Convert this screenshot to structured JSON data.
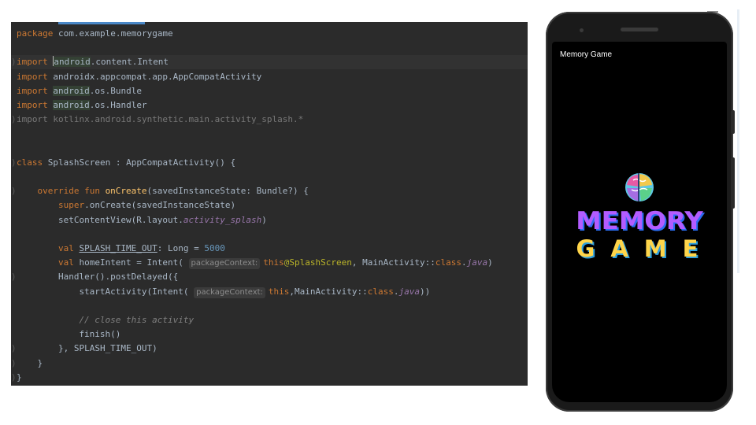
{
  "editor": {
    "lines": [
      {
        "row": 0,
        "indent": 0,
        "gutter": "",
        "segs": [
          [
            "package ",
            "kw"
          ],
          [
            "com.example.memorygame",
            ""
          ]
        ]
      },
      {
        "row": 2,
        "indent": 0,
        "gutter": ")",
        "caret": true,
        "segs": [
          [
            "import ",
            "kw"
          ],
          [
            "|",
            "cursor"
          ],
          [
            "android",
            "hl"
          ],
          [
            ".content.Intent",
            ""
          ]
        ]
      },
      {
        "row": 3,
        "indent": 0,
        "gutter": "",
        "segs": [
          [
            "import ",
            "kw"
          ],
          [
            "androidx.appcompat.app.AppCompatActivity",
            ""
          ]
        ]
      },
      {
        "row": 4,
        "indent": 0,
        "gutter": "",
        "segs": [
          [
            "import ",
            "kw"
          ],
          [
            "android",
            "hl"
          ],
          [
            ".os.Bundle",
            ""
          ]
        ]
      },
      {
        "row": 5,
        "indent": 0,
        "gutter": "",
        "segs": [
          [
            "import ",
            "kw"
          ],
          [
            "android",
            "hl"
          ],
          [
            ".os.Handler",
            ""
          ]
        ]
      },
      {
        "row": 6,
        "indent": 0,
        "gutter": ")",
        "segs": [
          [
            "import kotlinx.android.synthetic.main.activity_splash.*",
            "dim"
          ]
        ]
      },
      {
        "row": 9,
        "indent": 0,
        "gutter": ")",
        "segs": [
          [
            "class ",
            "kw"
          ],
          [
            "SplashScreen : AppCompatActivity() {",
            ""
          ]
        ]
      },
      {
        "row": 11,
        "indent": 4,
        "gutter": ")",
        "segs": [
          [
            "override fun ",
            "kw"
          ],
          [
            "onCreate",
            "fn"
          ],
          [
            "(savedInstanceState: Bundle?) {",
            ""
          ]
        ]
      },
      {
        "row": 12,
        "indent": 8,
        "gutter": "",
        "segs": [
          [
            "super",
            "kw"
          ],
          [
            ".onCreate(savedInstanceState)",
            ""
          ]
        ]
      },
      {
        "row": 13,
        "indent": 8,
        "gutter": "",
        "segs": [
          [
            "setContentView(R.layout.",
            ""
          ],
          [
            "activity_splash",
            "ital"
          ],
          [
            ")",
            ""
          ]
        ]
      },
      {
        "row": 15,
        "indent": 8,
        "gutter": "",
        "segs": [
          [
            "val ",
            "kw"
          ],
          [
            "SPLASH_TIME_OUT",
            "ul"
          ],
          [
            ": Long = ",
            ""
          ],
          [
            "5000",
            "num"
          ]
        ]
      },
      {
        "row": 16,
        "indent": 8,
        "gutter": "",
        "segs": [
          [
            "val ",
            "kw"
          ],
          [
            "homeIntent = Intent( ",
            ""
          ],
          [
            "packageContext:",
            "hint"
          ],
          [
            "this",
            "kw"
          ],
          [
            "@SplashScreen",
            "at"
          ],
          [
            ", MainActivity::",
            ""
          ],
          [
            "class",
            "kw"
          ],
          [
            ".",
            ""
          ],
          [
            "java",
            "ital"
          ],
          [
            ")",
            ""
          ]
        ]
      },
      {
        "row": 17,
        "indent": 8,
        "gutter": ")",
        "segs": [
          [
            "Handler().postDelayed({",
            ""
          ]
        ]
      },
      {
        "row": 18,
        "indent": 12,
        "gutter": "",
        "segs": [
          [
            "startActivity(Intent( ",
            ""
          ],
          [
            "packageContext:",
            "hint"
          ],
          [
            "this",
            "kw"
          ],
          [
            ",MainActivity::",
            ""
          ],
          [
            "class",
            "kw"
          ],
          [
            ".",
            ""
          ],
          [
            "java",
            "ital"
          ],
          [
            "))",
            ""
          ]
        ]
      },
      {
        "row": 20,
        "indent": 12,
        "gutter": "",
        "segs": [
          [
            "// close this activity",
            "cm"
          ]
        ]
      },
      {
        "row": 21,
        "indent": 12,
        "gutter": "",
        "segs": [
          [
            "finish()",
            ""
          ]
        ]
      },
      {
        "row": 22,
        "indent": 8,
        "gutter": ")",
        "segs": [
          [
            "}",
            ""
          ],
          [
            ", ",
            ""
          ],
          [
            "SPLASH_TIME_OUT)",
            ""
          ]
        ]
      },
      {
        "row": 23,
        "indent": 4,
        "gutter": ")",
        "segs": [
          [
            "}",
            ""
          ]
        ]
      },
      {
        "row": 24,
        "indent": 0,
        "gutter": ")",
        "segs": [
          [
            "}",
            ""
          ]
        ]
      }
    ]
  },
  "phone": {
    "app_title": "Memory Game",
    "splash_title_line1": "MEMORY",
    "splash_title_line2": "GAME",
    "logo_icon": "brain-puzzle-icon"
  },
  "colors": {
    "editor_bg": "#2b2b2b",
    "keyword": "#cc7832",
    "function": "#ffc66d",
    "number": "#6897bb",
    "memory_text": "#b35cff",
    "game_text": "#ffd54a"
  }
}
